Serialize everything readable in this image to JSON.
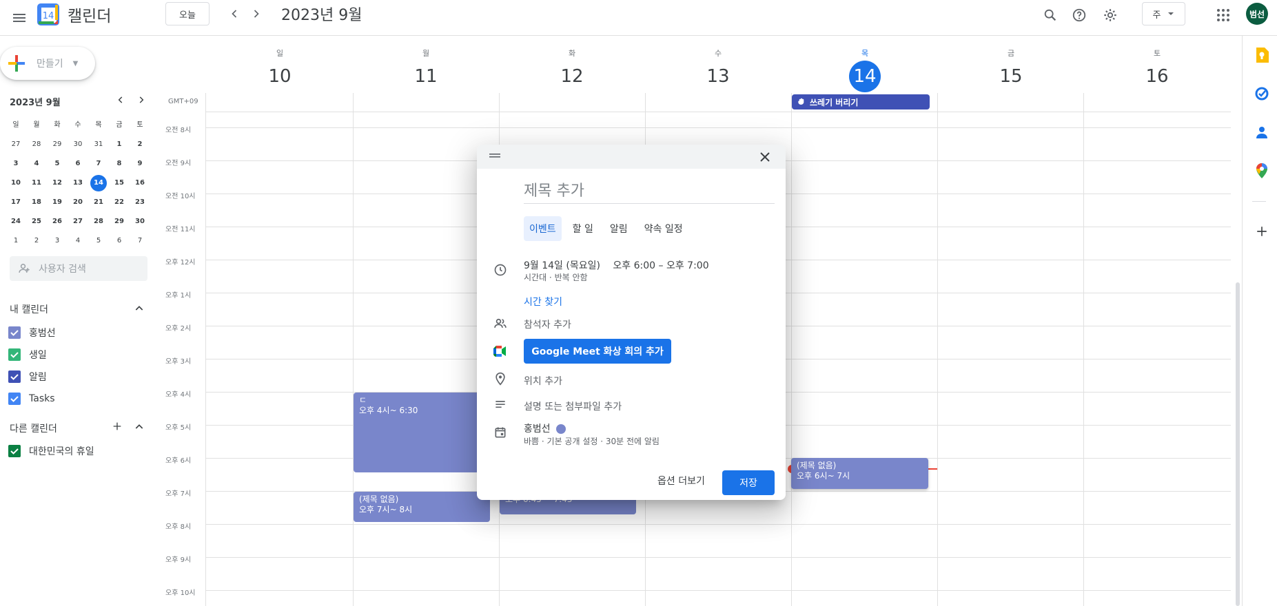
{
  "header": {
    "title": "캘린더",
    "logo_number": "14",
    "today_label": "오늘",
    "date_title": "2023년 9월",
    "view_label": "주",
    "avatar_text": "범선"
  },
  "sidebar": {
    "create_label": "만들기",
    "mini_title": "2023년 9월",
    "dow": [
      "일",
      "월",
      "화",
      "수",
      "목",
      "금",
      "토"
    ],
    "weeks": [
      [
        "27",
        "28",
        "29",
        "30",
        "31",
        "1",
        "2"
      ],
      [
        "3",
        "4",
        "5",
        "6",
        "7",
        "8",
        "9"
      ],
      [
        "10",
        "11",
        "12",
        "13",
        "14",
        "15",
        "16"
      ],
      [
        "17",
        "18",
        "19",
        "20",
        "21",
        "22",
        "23"
      ],
      [
        "24",
        "25",
        "26",
        "27",
        "28",
        "29",
        "30"
      ],
      [
        "1",
        "2",
        "3",
        "4",
        "5",
        "6",
        "7"
      ]
    ],
    "search_placeholder": "사용자 검색",
    "my_calendars_title": "내 캘린더",
    "my_calendars": [
      {
        "name": "홍범선",
        "color": "#7986cb"
      },
      {
        "name": "생일",
        "color": "#33b679"
      },
      {
        "name": "알림",
        "color": "#3f51b5"
      },
      {
        "name": "Tasks",
        "color": "#4285f4"
      }
    ],
    "other_calendars_title": "다른 캘린더",
    "other_calendars": [
      {
        "name": "대한민국의 휴일",
        "color": "#0b8043"
      }
    ]
  },
  "week": {
    "days": [
      {
        "dow": "일",
        "num": "10"
      },
      {
        "dow": "월",
        "num": "11"
      },
      {
        "dow": "화",
        "num": "12"
      },
      {
        "dow": "수",
        "num": "13"
      },
      {
        "dow": "목",
        "num": "14"
      },
      {
        "dow": "금",
        "num": "15"
      },
      {
        "dow": "토",
        "num": "16"
      }
    ],
    "timezone": "GMT+09",
    "hours": [
      "오전 8시",
      "오전 9시",
      "오전 10시",
      "오전 11시",
      "오후 12시",
      "오후 1시",
      "오후 2시",
      "오후 3시",
      "오후 4시",
      "오후 5시",
      "오후 6시",
      "오후 7시",
      "오후 8시",
      "오후 9시",
      "오후 10시"
    ]
  },
  "events": {
    "allday": "쓰레기 버리기",
    "e1_title": "ㄷ",
    "e1_time": "오후 4시~ 6:30",
    "e2_title": "(제목 없음)",
    "e2_time": "오후 7시~ 8시",
    "e3_time_partial": "오후 6:45 ~ 7:45",
    "e4_title": "(제목 없음)",
    "e4_time": "오후 6시~ 7시"
  },
  "dialog": {
    "title_placeholder": "제목 추가",
    "tabs": [
      "이벤트",
      "할 일",
      "알림",
      "약속 일정"
    ],
    "date_text": "9월 14일 (목요일)",
    "time_text": "오후 6:00  –  오후 7:00",
    "date_sub": "시간대 · 반복 안함",
    "find_time": "시간 찾기",
    "add_guests": "참석자 추가",
    "meet_button": "Google Meet 화상 회의 추가",
    "add_location": "위치 추가",
    "add_description": "설명 또는 첨부파일 추가",
    "calendar_name": "홍범선",
    "calendar_sub": "바쁨 · 기본 공개 설정 · 30분 전에 알림",
    "more_options": "옵션 더보기",
    "save": "저장"
  }
}
